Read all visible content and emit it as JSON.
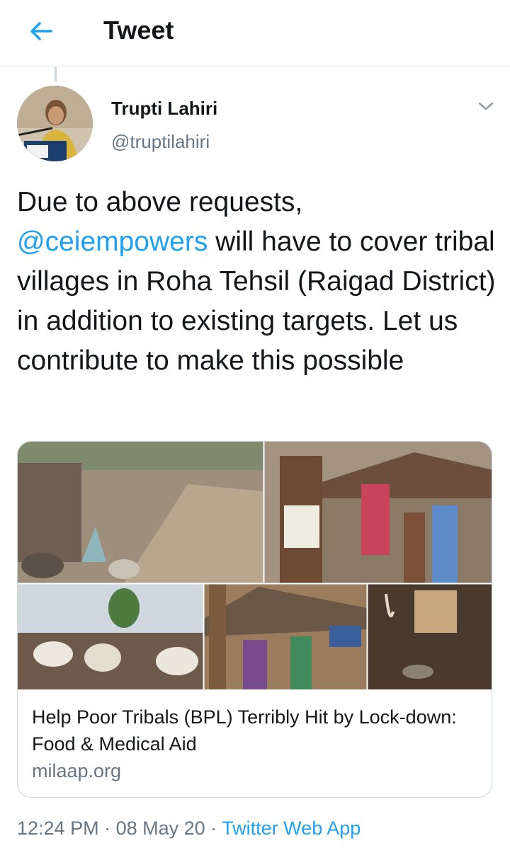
{
  "header": {
    "title": "Tweet",
    "back_icon": "arrow-left-icon",
    "accent": "#1da1f2"
  },
  "tweet": {
    "author_name": "Trupti Lahiri",
    "author_handle": "@truptilahiri",
    "text_before": "Due to above requests, ",
    "mention": "@ceiempowers",
    "text_after": " will have to cover tribal villages in Roha Tehsil (Raigad District) in addition to existing targets. Let us contribute to make this possible",
    "more_icon": "chevron-down-icon"
  },
  "card": {
    "title": "Help Poor Tribals (BPL) Terribly Hit by Lock-down: Food & Medical Aid",
    "domain": "milaap.org"
  },
  "meta": {
    "time": "12:24 PM",
    "sep1": " · ",
    "date": "08 May 20",
    "sep2": " · ",
    "source": "Twitter Web App"
  }
}
